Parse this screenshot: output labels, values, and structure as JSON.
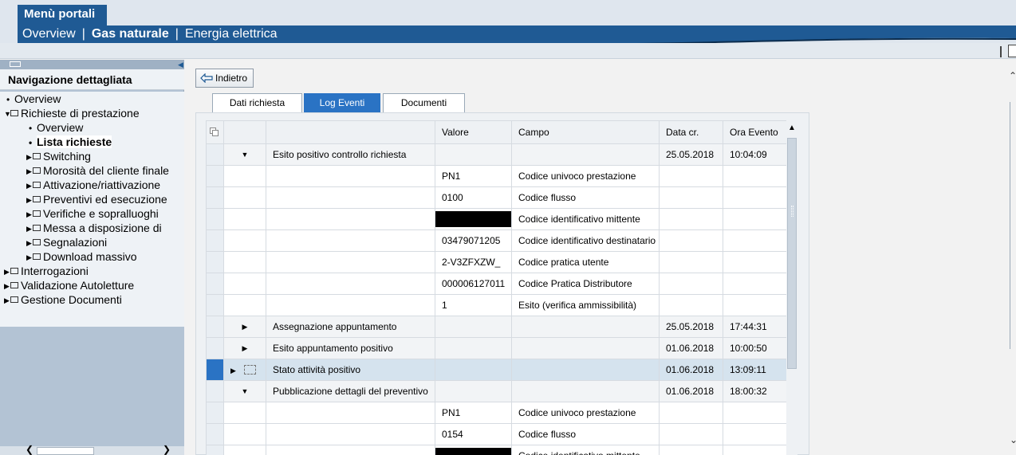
{
  "header": {
    "portal_title": "Menù portali",
    "nav": [
      "Overview",
      "Gas naturale",
      "Energia elettrica"
    ]
  },
  "sidebar": {
    "title": "Navigazione dettagliata",
    "items": [
      {
        "label": "Overview",
        "type": "leaf"
      },
      {
        "label": "Richieste di prestazione",
        "type": "folder-open"
      },
      {
        "label": "Overview",
        "type": "leaf"
      },
      {
        "label": "Lista richieste",
        "type": "leaf-selected"
      },
      {
        "label": "Switching",
        "type": "folder"
      },
      {
        "label": "Morosità del cliente finale",
        "type": "folder"
      },
      {
        "label": "Attivazione/riattivazione",
        "type": "folder"
      },
      {
        "label": "Preventivi ed esecuzione",
        "type": "folder"
      },
      {
        "label": "Verifiche e sopralluoghi",
        "type": "folder"
      },
      {
        "label": "Messa a disposizione di",
        "type": "folder"
      },
      {
        "label": "Segnalazioni",
        "type": "folder"
      },
      {
        "label": "Download massivo",
        "type": "folder"
      },
      {
        "label": "Interrogazioni",
        "type": "folder"
      },
      {
        "label": "Validazione Autoletture",
        "type": "folder"
      },
      {
        "label": "Gestione Documenti",
        "type": "folder"
      }
    ]
  },
  "toolbar": {
    "back_label": "Indietro"
  },
  "tabs": [
    {
      "label": "Dati richiesta",
      "active": false
    },
    {
      "label": "Log Eventi",
      "active": true
    },
    {
      "label": "Documenti",
      "active": false
    }
  ],
  "table": {
    "columns": [
      "",
      "Valore",
      "Campo",
      "Data cr.",
      "Ora Evento"
    ],
    "rows": [
      {
        "kind": "group",
        "expanded": true,
        "event": "Esito positivo controllo richiesta",
        "valore": "",
        "campo": "",
        "data": "25.05.2018",
        "ora": "10:04:09"
      },
      {
        "kind": "detail",
        "event": "",
        "valore": "PN1",
        "campo": "Codice univoco prestazione",
        "data": "",
        "ora": ""
      },
      {
        "kind": "detail",
        "event": "",
        "valore": "0100",
        "campo": "Codice flusso",
        "data": "",
        "ora": ""
      },
      {
        "kind": "detail",
        "event": "",
        "valore": "",
        "redacted": true,
        "campo": "Codice identificativo mittente",
        "data": "",
        "ora": ""
      },
      {
        "kind": "detail",
        "event": "",
        "valore": "03479071205",
        "campo": "Codice identificativo destinatario",
        "data": "",
        "ora": ""
      },
      {
        "kind": "detail",
        "event": "",
        "valore": "2-V3ZFXZW_",
        "campo": "Codice pratica utente",
        "data": "",
        "ora": ""
      },
      {
        "kind": "detail",
        "event": "",
        "valore": "000006127011",
        "campo": "Codice Pratica Distributore",
        "data": "",
        "ora": ""
      },
      {
        "kind": "detail",
        "event": "",
        "valore": "1",
        "campo": "Esito (verifica ammissibilità)",
        "data": "",
        "ora": ""
      },
      {
        "kind": "group",
        "expanded": false,
        "event": "Assegnazione appuntamento",
        "valore": "",
        "campo": "",
        "data": "25.05.2018",
        "ora": "17:44:31"
      },
      {
        "kind": "group",
        "expanded": false,
        "event": "Esito appuntamento positivo",
        "valore": "",
        "campo": "",
        "data": "01.06.2018",
        "ora": "10:00:50"
      },
      {
        "kind": "group",
        "expanded": false,
        "selected": true,
        "event": "Stato attività positivo",
        "valore": "",
        "campo": "",
        "data": "01.06.2018",
        "ora": "13:09:11"
      },
      {
        "kind": "group",
        "expanded": true,
        "event": "Pubblicazione dettagli del preventivo",
        "valore": "",
        "campo": "",
        "data": "01.06.2018",
        "ora": "18:00:32"
      },
      {
        "kind": "detail",
        "event": "",
        "valore": "PN1",
        "campo": "Codice univoco prestazione",
        "data": "",
        "ora": ""
      },
      {
        "kind": "detail",
        "event": "",
        "valore": "0154",
        "campo": "Codice flusso",
        "data": "",
        "ora": ""
      },
      {
        "kind": "detail",
        "event": "",
        "valore": "",
        "redacted": true,
        "campo": "Codice identificativo mittente",
        "data": "",
        "ora": ""
      }
    ]
  },
  "colors": {
    "brand": "#1f5a94",
    "accent": "#2a73c4",
    "sidebar": "#b3c3d4"
  }
}
